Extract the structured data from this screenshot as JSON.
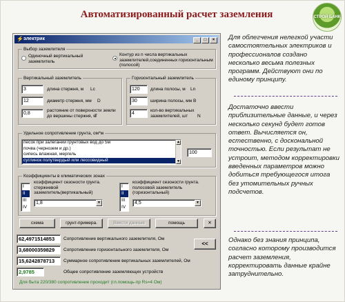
{
  "page": {
    "title": "Автоматизированный расчет заземления",
    "logo_text": "СТРОЙ БАНК"
  },
  "window": {
    "title": "электрик",
    "icon": "lightning-icon",
    "controls": [
      "_",
      "□",
      "×"
    ]
  },
  "grounding_choice": {
    "legend": "Выбор заземлителя",
    "options": [
      {
        "label": "Одиночный вертикальный заземлитель",
        "selected": false
      },
      {
        "label": "Контур из n числа вертикальных заземлителей,соединенных горизонтальным (полосой)",
        "selected": true
      }
    ]
  },
  "vertical": {
    "legend": "Вертикальный заземлитель",
    "fields": [
      {
        "value": "3",
        "label": "длина стержня, м",
        "unit": "Lc"
      },
      {
        "value": "12",
        "label": "диаметр стержня, мм",
        "unit": "D"
      },
      {
        "value": "0,8",
        "label": "растояние от поверхности земли до вершины стержня, м",
        "unit": "T"
      }
    ]
  },
  "horizontal": {
    "legend": "Горизонтальный заземлитель",
    "fields": [
      {
        "value": "120",
        "label": "длина полосы, м",
        "unit": "Ln"
      },
      {
        "value": "30",
        "label": "ширина полосы, мм",
        "unit": "B"
      },
      {
        "value": "4",
        "label": "кол-во вертикальных заземлителей, шт",
        "unit": "N"
      }
    ]
  },
  "soil": {
    "legend": "Удельное сопротивление грунта, ом*м",
    "items": [
      "песок при залегании грунтовых вод до 5м",
      "почва (чернозем и др.)",
      "сипесь влажная, мергель",
      "суглинок полутвердый или лессовидный"
    ],
    "selected_index": 3,
    "value": "100"
  },
  "climate": {
    "legend": "Коэффициенты в климатических зонах",
    "vertical": {
      "label": "коэффициент сезоности грунта. стержневой заземлитель(вертикальный)",
      "zones": [
        "I",
        "II",
        "III",
        "IV"
      ],
      "selected_index": 1,
      "value": "1,8"
    },
    "horizontal": {
      "label": "коэффициент сезоности грунта. полосовой заземлитель (горизонтальный)",
      "zones": [
        "I",
        "II",
        "III",
        "IV"
      ],
      "selected_index": 1,
      "value": "4,5"
    }
  },
  "buttons": {
    "scheme": "схема",
    "example": "грунт-примера.",
    "enter_data": "Ввести данные",
    "help": "помощь",
    "close": "✕",
    "back": "<<"
  },
  "results": [
    {
      "value": "62,4971514853",
      "label": "Сопротивление вертикального заземлителя, Ом"
    },
    {
      "value": "3,68000359829",
      "label": "Сопротивление горизонтального заземлителя, Ом"
    },
    {
      "value": "15,6242878713",
      "label": "Суммарное сопротивление вертикальных заземлителей, Ом"
    },
    {
      "value": "2,9785",
      "label": "Общее сопротивление заземляющих устройств"
    }
  ],
  "status": "Для быта 220/380 сопротивление проходит (гл.помощь-пр Rs=4 Ом)",
  "article": {
    "p1": "Для облегчения нелегкой участи самостоятельных электриков и профессионалов создано несколько весьма полезных программ. Действуют они по единому принципу.",
    "p2": "Достаточно ввести приблизительные данные, и через несколько секунд будет готов ответ. Вычисляется он, естественно, с доскональной точностью. Если результат не устроит, методом корректировки введенных параметров можно добиться требующегося итога без утомительных ручных подсчетов.",
    "p3": "Однако без знания принципа, согласно которому производится расчет заземления, корректировать данные крайне затруднительно."
  },
  "colors": {
    "title": "#8b1a1a",
    "window_titlebar": "#0a246a",
    "selection": "#0a246a",
    "status_text": "#1f7a1f",
    "separator": "#5a3d8a"
  }
}
